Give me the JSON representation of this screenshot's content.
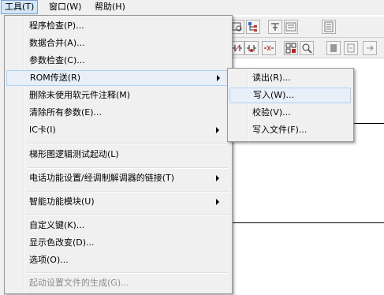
{
  "menubar": {
    "items": [
      {
        "label": "工具(T)"
      },
      {
        "label": "窗口(W)"
      },
      {
        "label": "帮助(H)"
      }
    ]
  },
  "tools_menu": {
    "items": [
      {
        "label": "程序检查(P)..."
      },
      {
        "label": "数据合并(A)..."
      },
      {
        "label": "参数检查(C)..."
      },
      {
        "label": "ROM传送(R)"
      },
      {
        "label": "删除未使用软元件注释(M)"
      },
      {
        "label": "清除所有参数(E)..."
      },
      {
        "label": "IC卡(I)"
      },
      {
        "label": "梯形图逻辑测试起动(L)"
      },
      {
        "label": "电话功能设置/经调制解调器的链接(T)"
      },
      {
        "label": "智能功能模块(U)"
      },
      {
        "label": "自定义键(K)..."
      },
      {
        "label": "显示色改变(D)..."
      },
      {
        "label": "选项(O)..."
      },
      {
        "label": "起动设置文件的生成(G)..."
      }
    ]
  },
  "rom_submenu": {
    "items": [
      {
        "label": "读出(R)..."
      },
      {
        "label": "写入(W)..."
      },
      {
        "label": "校验(V)..."
      },
      {
        "label": "写入文件(F)..."
      }
    ]
  },
  "toolbar": {
    "icons": [
      "ladder-monitor-icon",
      "tree-icon",
      "write-icon",
      "read-icon",
      "compare-icon",
      "contact-icon",
      "coil-icon",
      "edit-icon",
      "grid-icon",
      "zoom-icon",
      "step-icon",
      "step-icon-2",
      "arrow-icon"
    ]
  },
  "colors": {
    "menu_bg": "#f0f0f0",
    "highlight_bg": "#e8eff8",
    "highlight_border": "#aecff7",
    "disabled_text": "#8d8d8d"
  }
}
